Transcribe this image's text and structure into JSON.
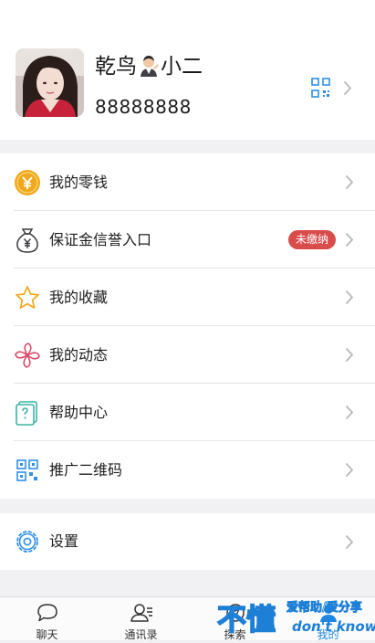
{
  "profile": {
    "name_part1": "乾鸟",
    "name_part2": "小二",
    "account_id": "88888888"
  },
  "menu": {
    "wallet": "我的零钱",
    "deposit": "保证金信誉入口",
    "deposit_badge": "未缴纳",
    "favorites": "我的收藏",
    "moments": "我的动态",
    "help": "帮助中心",
    "promo_qr": "推广二维码",
    "settings": "设置"
  },
  "tabs": {
    "chat": "聊天",
    "contacts": "通讯录",
    "explore": "探索",
    "me": "我的"
  },
  "watermark": {
    "main": "不懂",
    "sub": "爱帮助/爱分享",
    "en": "don't know"
  },
  "colors": {
    "accent": "#1d86e0",
    "badge": "#d94c4c",
    "coin": "#f0a91c"
  }
}
